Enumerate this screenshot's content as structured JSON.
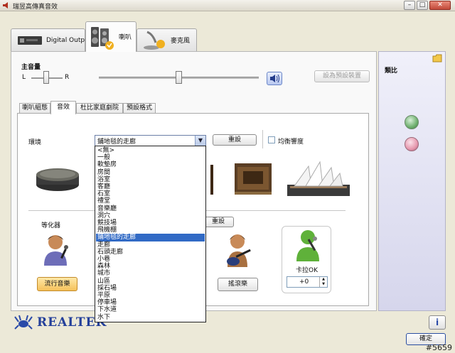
{
  "window": {
    "title": "瑞昱高傳真音效"
  },
  "device_tabs": [
    {
      "label": "Digital Output"
    },
    {
      "label": "喇叭"
    },
    {
      "label": "麥克風"
    }
  ],
  "volume": {
    "label": "主音量",
    "balance_left": "L",
    "balance_right": "R",
    "set_default_label": "設為預設裝置"
  },
  "sub_tabs": [
    {
      "label": "喇叭組態"
    },
    {
      "label": "音效"
    },
    {
      "label": "杜比家庭劇院"
    },
    {
      "label": "預設格式"
    }
  ],
  "environment": {
    "label": "環境",
    "selected": "鋪地毯的走廊",
    "reset_label": "重設",
    "loudness_label": "均衡響度",
    "options": [
      "<無>",
      "一般",
      "軟墊房",
      "房間",
      "浴室",
      "客廳",
      "石室",
      "禮堂",
      "音樂廳",
      "洞穴",
      "競技場",
      "飛機棚",
      "鋪地毯的走廊",
      "走廊",
      "石頭走廊",
      "小巷",
      "森林",
      "城市",
      "山區",
      "採石場",
      "平原",
      "停車場",
      "下水道",
      "水下"
    ],
    "selected_index": 12
  },
  "equalizer": {
    "label": "等化器",
    "reset_label": "重設",
    "preset_pop": "流行音樂",
    "preset_rock": "搖滾樂"
  },
  "karaoke": {
    "label": "卡拉OK",
    "value": "+0"
  },
  "right_panel": {
    "analog_label": "類比"
  },
  "brand": {
    "name": "REALTEK"
  },
  "ok_label": "確定",
  "watermark": "#5659"
}
